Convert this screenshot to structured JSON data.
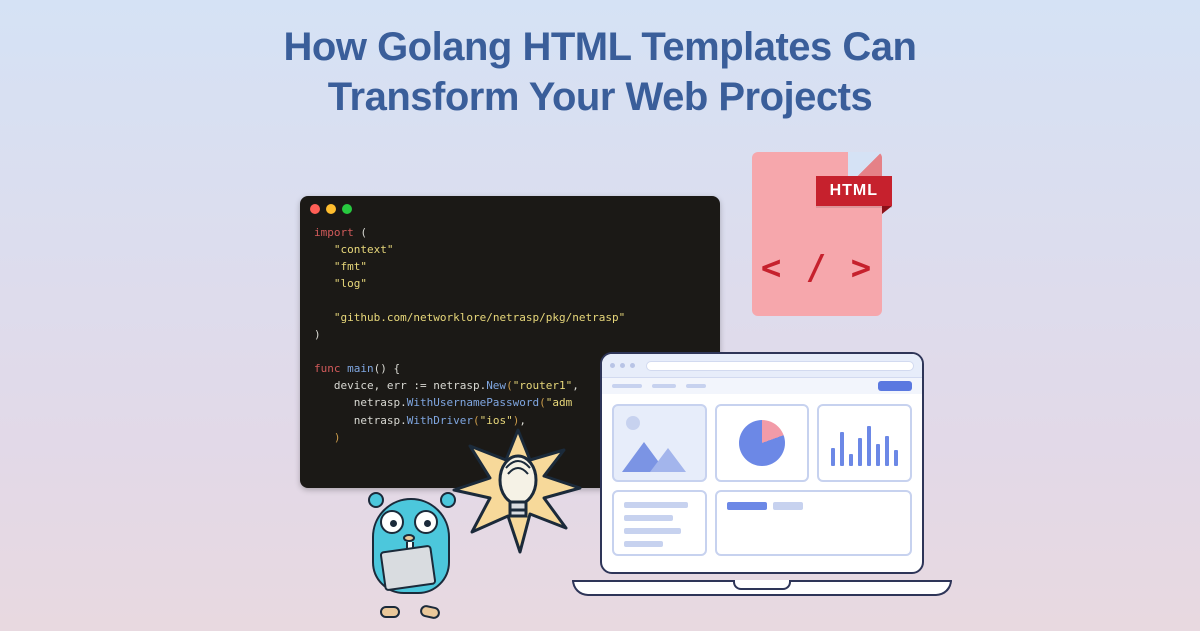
{
  "title": {
    "line1": "How Golang HTML Templates Can",
    "line2": "Transform Your Web Projects"
  },
  "editor": {
    "code_lines": [
      {
        "segments": [
          {
            "t": "import",
            "c": "kw"
          },
          {
            "t": " (",
            "c": ""
          }
        ]
      },
      {
        "segments": [
          {
            "t": "   ",
            "c": ""
          },
          {
            "t": "\"context\"",
            "c": "str"
          }
        ]
      },
      {
        "segments": [
          {
            "t": "   ",
            "c": ""
          },
          {
            "t": "\"fmt\"",
            "c": "str"
          }
        ]
      },
      {
        "segments": [
          {
            "t": "   ",
            "c": ""
          },
          {
            "t": "\"log\"",
            "c": "str"
          }
        ]
      },
      {
        "segments": [
          {
            "t": " ",
            "c": ""
          }
        ]
      },
      {
        "segments": [
          {
            "t": "   ",
            "c": ""
          },
          {
            "t": "\"github.com/networklore/netrasp/pkg/netrasp\"",
            "c": "str"
          }
        ]
      },
      {
        "segments": [
          {
            "t": ")",
            "c": ""
          }
        ]
      },
      {
        "segments": [
          {
            "t": " ",
            "c": ""
          }
        ]
      },
      {
        "segments": [
          {
            "t": "func",
            "c": "kw"
          },
          {
            "t": " ",
            "c": ""
          },
          {
            "t": "main",
            "c": "fn"
          },
          {
            "t": "() {",
            "c": ""
          }
        ]
      },
      {
        "segments": [
          {
            "t": "   device, err := netrasp.",
            "c": ""
          },
          {
            "t": "New",
            "c": "fn"
          },
          {
            "t": "(",
            "c": "par"
          },
          {
            "t": "\"router1\"",
            "c": "str"
          },
          {
            "t": ",",
            "c": ""
          }
        ]
      },
      {
        "segments": [
          {
            "t": "      netrasp.",
            "c": ""
          },
          {
            "t": "WithUsernamePassword",
            "c": "fn"
          },
          {
            "t": "(",
            "c": "par"
          },
          {
            "t": "\"adm",
            "c": "str"
          }
        ]
      },
      {
        "segments": [
          {
            "t": "      netrasp.",
            "c": ""
          },
          {
            "t": "WithDriver",
            "c": "fn"
          },
          {
            "t": "(",
            "c": "par"
          },
          {
            "t": "\"ios\"",
            "c": "str"
          },
          {
            "t": ")",
            "c": "par"
          },
          {
            "t": ",",
            "c": ""
          }
        ]
      },
      {
        "segments": [
          {
            "t": "   ",
            "c": ""
          },
          {
            "t": ")",
            "c": "par"
          }
        ]
      }
    ]
  },
  "html_file": {
    "label": "HTML",
    "glyph": "< / >"
  },
  "laptop": {
    "bars": [
      18,
      34,
      12,
      28,
      40,
      22,
      30,
      16
    ]
  },
  "colors": {
    "title": "#3a5e9a",
    "editor_bg": "#1b1916",
    "html_badge": "#c6212d",
    "gopher": "#4cc7dc",
    "dashboard_blue": "#6c88e6"
  }
}
